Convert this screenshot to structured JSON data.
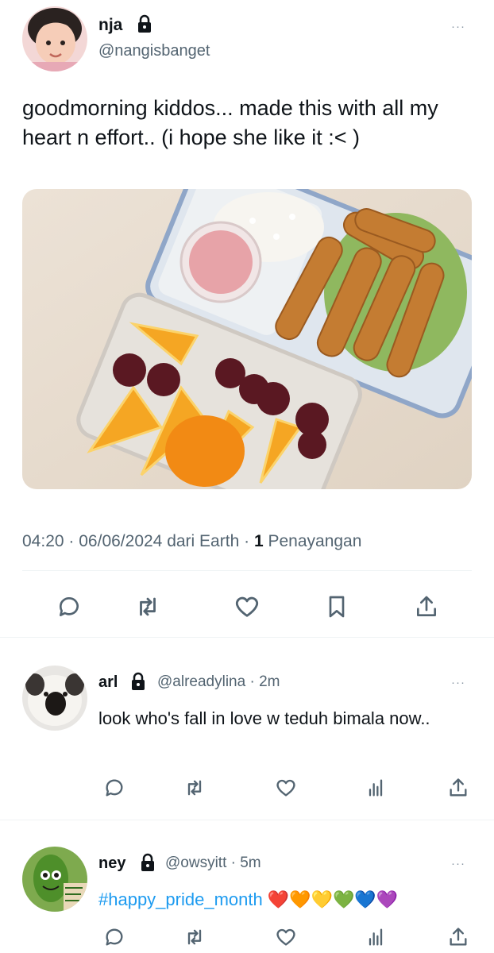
{
  "tweet": {
    "display_name": "nja",
    "handle": "@nangisbanget",
    "more_label": "···",
    "text": "goodmorning kiddos... made this with all my heart n effort.. (i hope she like it :< )",
    "time": "04:20",
    "date": "06/06/2024",
    "source": "dari Earth",
    "views_count": "1",
    "views_label": "Penayangan",
    "dot": "·"
  },
  "replies": [
    {
      "display_name": "arl",
      "handle_time": "@alreadylina · 2m",
      "text": "look who's fall in love w teduh bimala now.."
    },
    {
      "display_name": "ney",
      "handle_time": "@owsyitt · 5m",
      "text": "#happy_pride_month",
      "emojis": "❤️🧡💛💚💙💜"
    }
  ],
  "icons": [
    "reply-icon",
    "retweet-icon",
    "like-icon",
    "bookmark-icon",
    "share-icon",
    "views-icon",
    "lock-icon",
    "more-icon"
  ],
  "colors": {
    "text": "#0f1419",
    "muted": "#536471",
    "link": "#1d9bf0",
    "divider": "#eff3f4"
  }
}
